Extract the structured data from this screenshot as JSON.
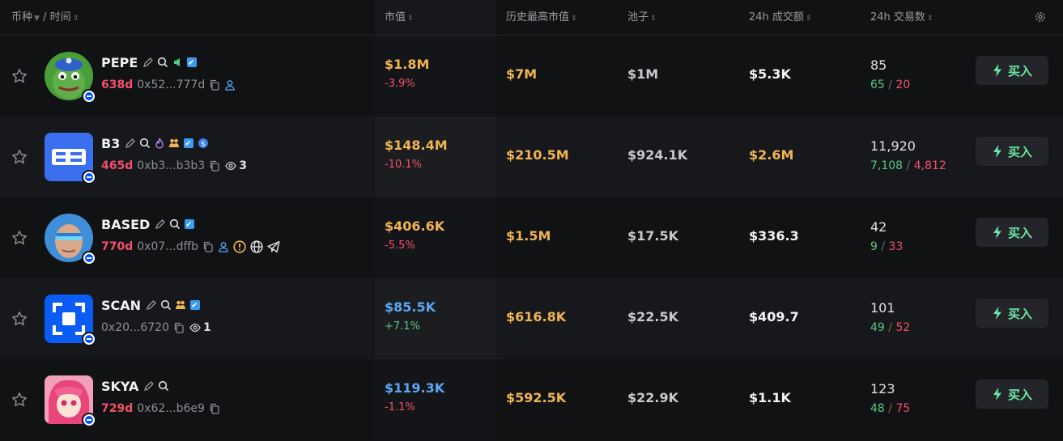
{
  "header": {
    "coin_label": "币种",
    "time_label": "时间",
    "separator": "/",
    "market_cap": "市值",
    "ath_market_cap": "历史最高市值",
    "pool": "池子",
    "volume_24h": "24h 成交额",
    "tx_24h": "24h 交易数"
  },
  "buy_label": "买入",
  "rows": [
    {
      "symbol": "PEPE",
      "age": "638d",
      "address": "0x52...777d",
      "market_cap": "$1.8M",
      "mc_color": "gold",
      "change": "-3.9%",
      "change_color": "red",
      "ath": "$7M",
      "pool": "$1M",
      "volume": "$5.3K",
      "volume_color": "white",
      "tx": "85",
      "buys": "65",
      "sells": "20"
    },
    {
      "symbol": "B3",
      "age": "465d",
      "address": "0xb3...b3b3",
      "watchers": "3",
      "market_cap": "$148.4M",
      "mc_color": "gold",
      "change": "-10.1%",
      "change_color": "red",
      "ath": "$210.5M",
      "pool": "$924.1K",
      "volume": "$2.6M",
      "volume_color": "gold",
      "tx": "11,920",
      "buys": "7,108",
      "sells": "4,812"
    },
    {
      "symbol": "BASED",
      "age": "770d",
      "address": "0x07...dffb",
      "market_cap": "$406.6K",
      "mc_color": "gold",
      "change": "-5.5%",
      "change_color": "red",
      "ath": "$1.5M",
      "pool": "$17.5K",
      "volume": "$336.3",
      "volume_color": "white",
      "tx": "42",
      "buys": "9",
      "sells": "33"
    },
    {
      "symbol": "SCAN",
      "address": "0x20...6720",
      "watchers": "1",
      "market_cap": "$85.5K",
      "mc_color": "blue",
      "change": "+7.1%",
      "change_color": "green",
      "ath": "$616.8K",
      "pool": "$22.5K",
      "volume": "$409.7",
      "volume_color": "white",
      "tx": "101",
      "buys": "49",
      "sells": "52"
    },
    {
      "symbol": "SKYA",
      "age": "729d",
      "address": "0x62...b6e9",
      "market_cap": "$119.3K",
      "mc_color": "blue",
      "change": "-1.1%",
      "change_color": "red",
      "ath": "$592.5K",
      "pool": "$22.9K",
      "volume": "$1.1K",
      "volume_color": "white",
      "tx": "123",
      "buys": "48",
      "sells": "75"
    }
  ]
}
